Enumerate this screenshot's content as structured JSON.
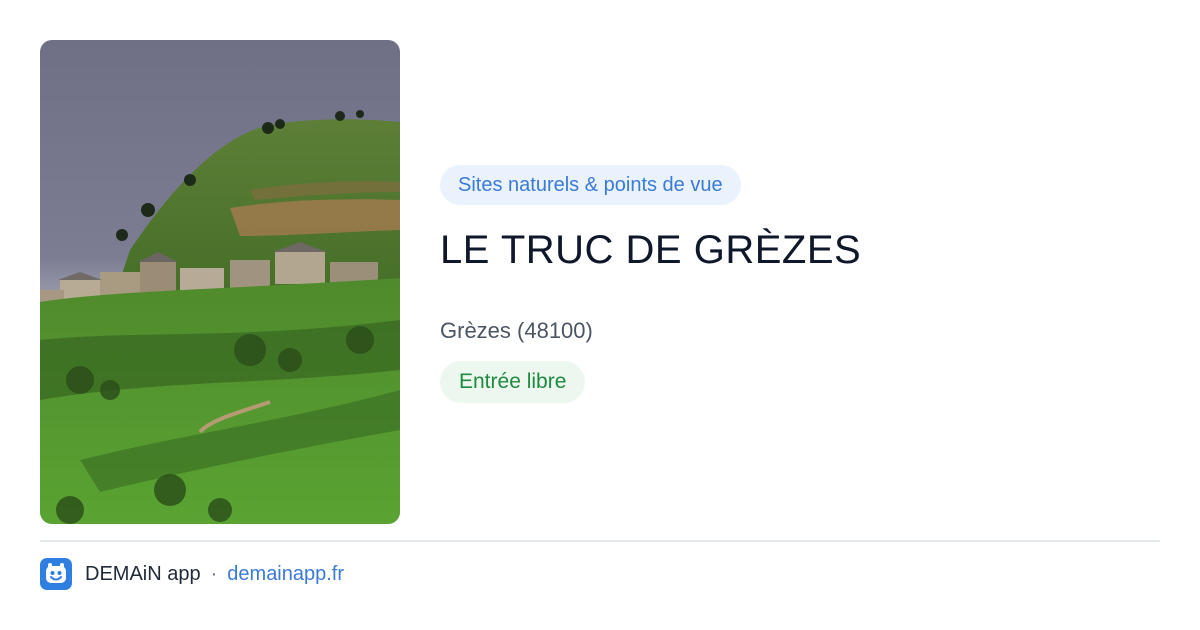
{
  "card": {
    "category": "Sites naturels & points de vue",
    "title": "LE TRUC DE GRÈZES",
    "location": "Grèzes (48100)",
    "access": "Entrée libre"
  },
  "footer": {
    "app_name": "DEMAiN app",
    "separator": "·",
    "site": "demainapp.fr"
  },
  "colors": {
    "category_text": "#3a7bd5",
    "category_bg": "#eaf2fd",
    "access_text": "#1f8a3f",
    "access_bg": "#ecf8ef",
    "link": "#3a7bd5",
    "logo_bg": "#2f7fe0"
  },
  "icons": {
    "app_logo": "demain-logo-icon"
  }
}
